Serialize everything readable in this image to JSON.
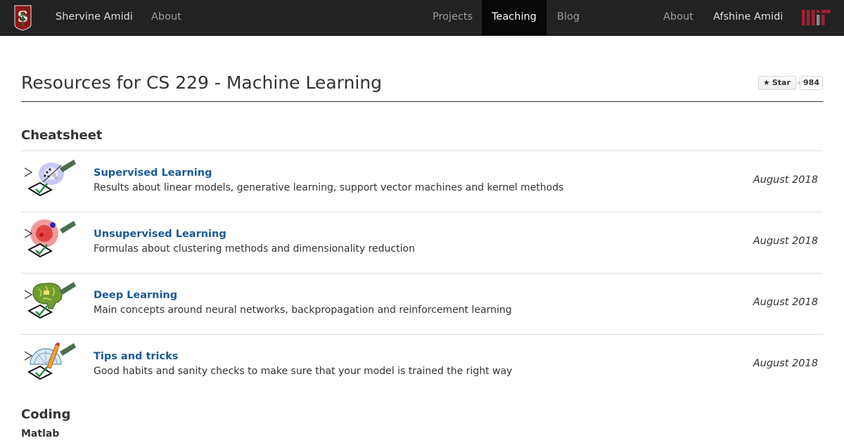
{
  "navbar": {
    "brand_left": "Shervine Amidi",
    "about_left": "About",
    "projects": "Projects",
    "teaching": "Teaching",
    "blog": "Blog",
    "about_right": "About",
    "brand_right": "Afshine Amidi",
    "stanford_logo_letter": "S"
  },
  "page": {
    "title": "Resources for CS 229 - Machine Learning",
    "star_label": "Star",
    "star_count": "984"
  },
  "cheatsheet": {
    "heading": "Cheatsheet",
    "items": [
      {
        "title": "Supervised Learning",
        "description": "Results about linear models, generative learning, support vector machines and kernel methods",
        "date": "August 2018",
        "icon": "supervised-learning-icon"
      },
      {
        "title": "Unsupervised Learning",
        "description": "Formulas about clustering methods and dimensionality reduction",
        "date": "August 2018",
        "icon": "unsupervised-learning-icon"
      },
      {
        "title": "Deep Learning",
        "description": "Main concepts around neural networks, backpropagation and reinforcement learning",
        "date": "August 2018",
        "icon": "deep-learning-icon"
      },
      {
        "title": "Tips and tricks",
        "description": "Good habits and sanity checks to make sure that your model is trained the right way",
        "date": "August 2018",
        "icon": "tips-and-tricks-icon"
      }
    ]
  },
  "coding": {
    "heading": "Coding",
    "subheading": "Matlab"
  },
  "colors": {
    "navbar_bg": "#222222",
    "navbar_active_bg": "#080808",
    "link_blue": "#1a5a96",
    "stanford_red": "#8c1515",
    "mit_red": "#a31f34"
  }
}
